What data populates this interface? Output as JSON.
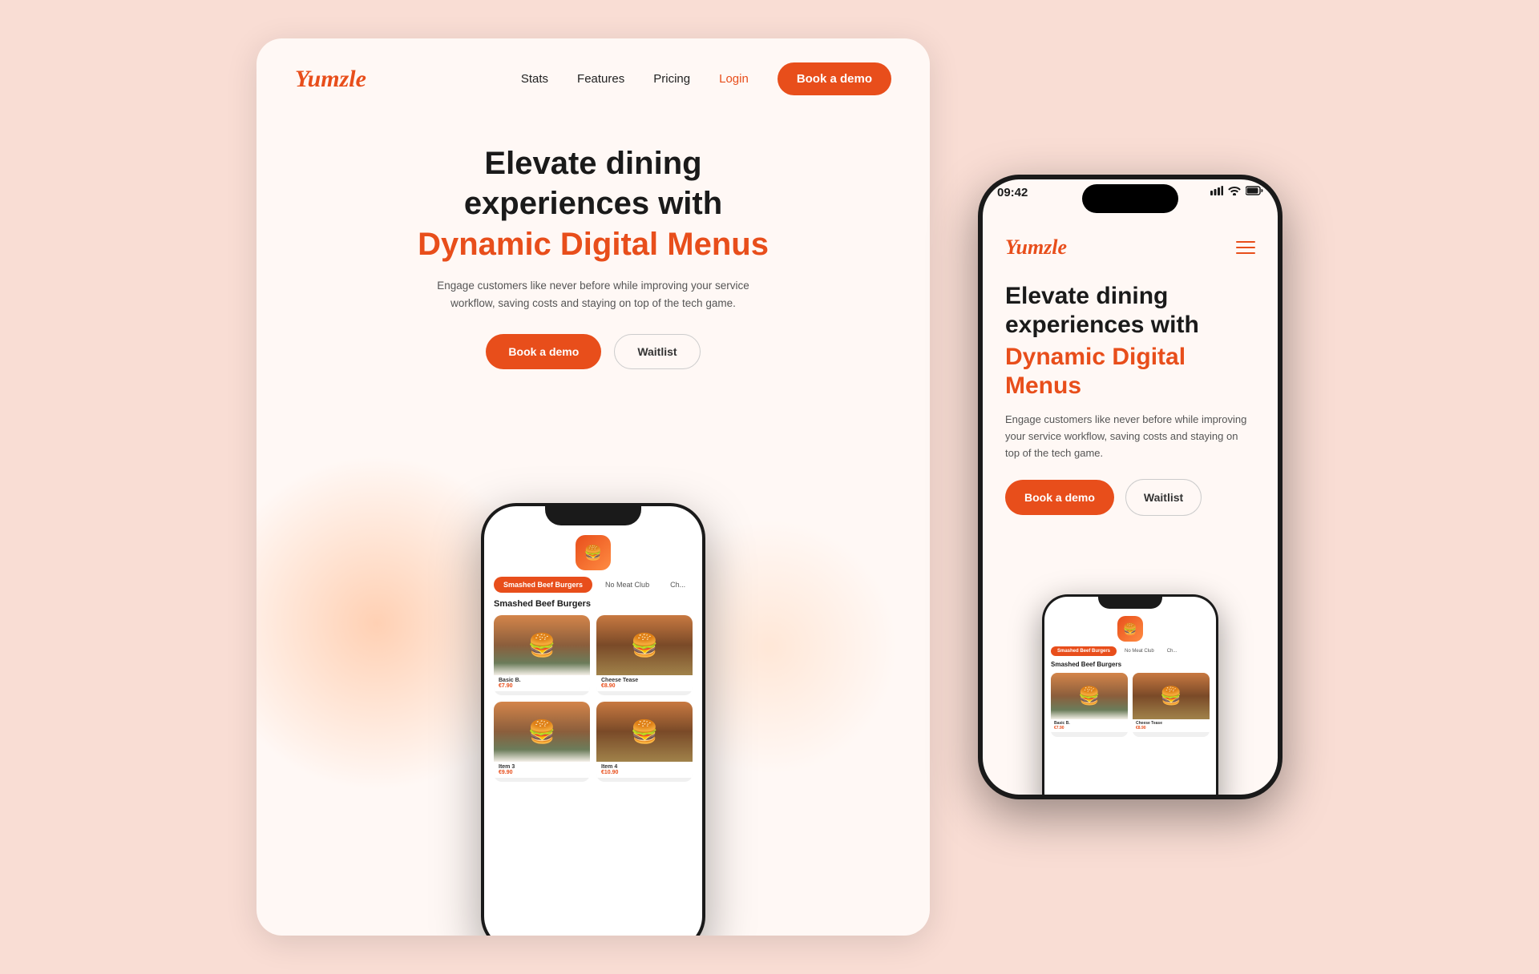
{
  "colors": {
    "brand_orange": "#e84e1b",
    "background": "#f9ddd4",
    "card_bg": "#fff8f5",
    "text_dark": "#1a1a1a",
    "text_muted": "#555555",
    "text_nav": "#222222"
  },
  "desktop": {
    "logo": "Yumzle",
    "nav": {
      "links": [
        "Stats",
        "Features",
        "Pricing",
        "Login"
      ],
      "cta_label": "Book a demo"
    },
    "hero": {
      "title_line1": "Elevate dining",
      "title_line2": "experiences with",
      "title_orange": "Dynamic Digital Menus",
      "subtitle": "Engage customers like never before while improving your service workflow, saving costs and staying on top of the tech game.",
      "btn_demo": "Book a demo",
      "btn_waitlist": "Waitlist"
    },
    "phone": {
      "logo_emoji": "🍔",
      "tabs": [
        "Smashed Beef Burgers",
        "No Meat Club",
        "Ch..."
      ],
      "section_title": "Smashed Beef Burgers",
      "food_items": [
        {
          "name": "Basic B.",
          "price": "€7.90",
          "emoji": "🍔"
        },
        {
          "name": "Cheese Tease",
          "price": "€8.90",
          "emoji": "🍔"
        },
        {
          "name": "Item 3",
          "price": "€9.90",
          "emoji": "🍔"
        },
        {
          "name": "Item 4",
          "price": "€10.90",
          "emoji": "🍔"
        }
      ]
    }
  },
  "mobile": {
    "status_bar": {
      "time": "09:42",
      "signal_icon": "▲▲▲",
      "wifi_icon": "WiFi",
      "battery_icon": "🔋"
    },
    "logo": "Yumzle",
    "hero": {
      "title_line1": "Elevate dining",
      "title_line2": "experiences with",
      "title_orange_line1": "Dynamic Digital",
      "title_orange_line2": "Menus",
      "subtitle": "Engage customers like never before while improving your service workflow, saving costs and staying on top of the tech game.",
      "btn_demo": "Book a demo",
      "btn_waitlist": "Waitlist"
    },
    "nested_phone": {
      "tabs": [
        "Smashed Beef Burgers",
        "No Meat Club",
        "Ch..."
      ],
      "section_title": "Smashed Beef Burgers",
      "food_items": [
        {
          "name": "Basic B.",
          "price": "€7.90",
          "emoji": "🍔"
        },
        {
          "name": "Cheese Tease",
          "price": "€8.90",
          "emoji": "🍔"
        }
      ]
    }
  }
}
